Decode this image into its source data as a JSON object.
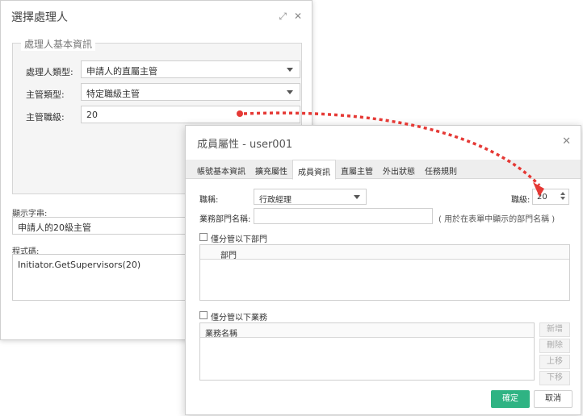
{
  "back_dialog": {
    "title": "選擇處理人",
    "legend": "處理人基本資訊",
    "handler_type_label": "處理人類型:",
    "handler_type_value": "申請人的直屬主管",
    "manager_type_label": "主管類型:",
    "manager_type_value": "特定職級主管",
    "manager_level_label": "主管職級:",
    "manager_level_value": "20",
    "display_string_label": "顯示字串:",
    "display_string_value": "申請人的20級主管",
    "code_label": "程式碼:",
    "code_value": "Initiator.GetSupervisors(20)"
  },
  "front_dialog": {
    "title": "成員屬性 - user001",
    "tabs": [
      "帳號基本資訊",
      "擴充屬性",
      "成員資訊",
      "直屬主管",
      "外出狀態",
      "任務規則"
    ],
    "active_tab_index": 2,
    "position_label": "職稱:",
    "position_value": "行政經理",
    "level_label": "職級:",
    "level_value": "20",
    "dept_name_label": "業務部門名稱:",
    "dept_name_hint": "( 用於在表單中顯示的部門名稱 )",
    "only_manage_depts_label": "僅分管以下部門",
    "dept_column": "部門",
    "only_manage_business_label": "僅分管以下業務",
    "business_column": "業務名稱",
    "side_buttons": [
      "新增",
      "刪除",
      "上移",
      "下移"
    ],
    "ok_label": "確定",
    "cancel_label": "取消"
  },
  "colors": {
    "accent": "#2fb383",
    "arrow": "#e53935"
  }
}
